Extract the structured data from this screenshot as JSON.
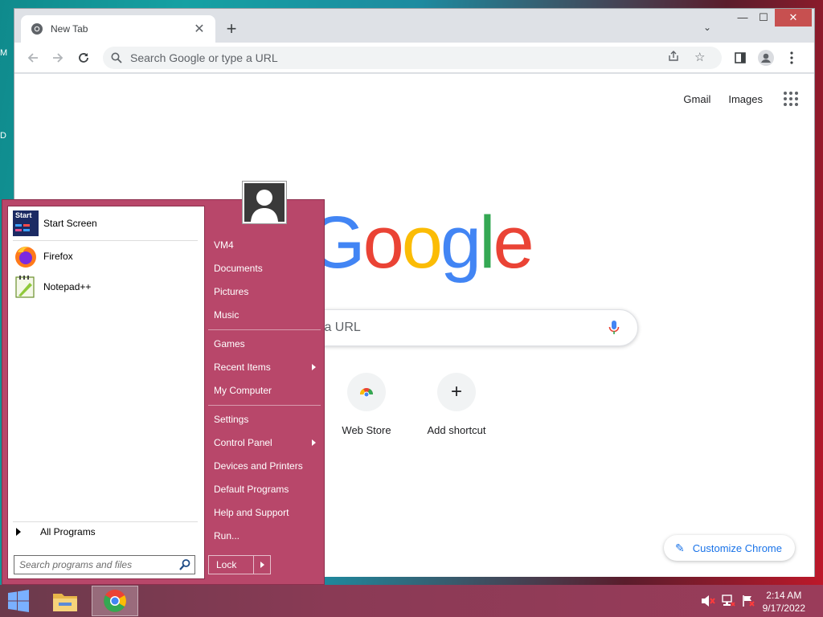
{
  "desktop": {
    "label_m": "M",
    "label_d": "D"
  },
  "chrome": {
    "tab_title": "New Tab",
    "tab_close": "✕",
    "new_tab": "+",
    "tab_list": "⌄",
    "minimize": "—",
    "maximize": "☐",
    "close": "✕",
    "omnibox_placeholder": "Search Google or type a URL",
    "top_links": {
      "gmail": "Gmail",
      "images": "Images"
    },
    "logo_letters": [
      {
        "ch": "G",
        "color": "#4285f4"
      },
      {
        "ch": "o",
        "color": "#ea4335"
      },
      {
        "ch": "o",
        "color": "#fbbc05"
      },
      {
        "ch": "g",
        "color": "#4285f4"
      },
      {
        "ch": "l",
        "color": "#34a853"
      },
      {
        "ch": "e",
        "color": "#ea4335"
      }
    ],
    "search_placeholder": "r type a URL",
    "shortcuts": [
      {
        "label": "Web Store",
        "icon": "chrome-web-store-icon"
      },
      {
        "label": "Add shortcut",
        "icon": "plus-icon",
        "glyph": "+"
      }
    ],
    "customize_label": "Customize Chrome",
    "customize_glyph": "✎"
  },
  "start_menu": {
    "pinned": [
      {
        "label": "Start Screen",
        "icon_text": "Start"
      },
      {
        "label": "Firefox"
      },
      {
        "label": "Notepad++"
      }
    ],
    "all_programs": "All Programs",
    "search_placeholder": "Search programs and files",
    "right_links": [
      {
        "label": "VM4"
      },
      {
        "label": "Documents"
      },
      {
        "label": "Pictures"
      },
      {
        "label": "Music"
      },
      {
        "label": "Games"
      },
      {
        "label": "Recent Items",
        "submenu": true
      },
      {
        "label": "My Computer"
      },
      {
        "label": "Settings"
      },
      {
        "label": "Control Panel",
        "submenu": true
      },
      {
        "label": "Devices and Printers"
      },
      {
        "label": "Default Programs"
      },
      {
        "label": "Help and Support"
      },
      {
        "label": "Run..."
      }
    ],
    "lock_label": "Lock"
  },
  "taskbar": {
    "time": "2:14 AM",
    "date": "9/17/2022"
  },
  "colors": {
    "start_menu_bg": "#b8476a",
    "chrome_frame": "#dee1e6",
    "link_blue": "#1a73e8"
  }
}
